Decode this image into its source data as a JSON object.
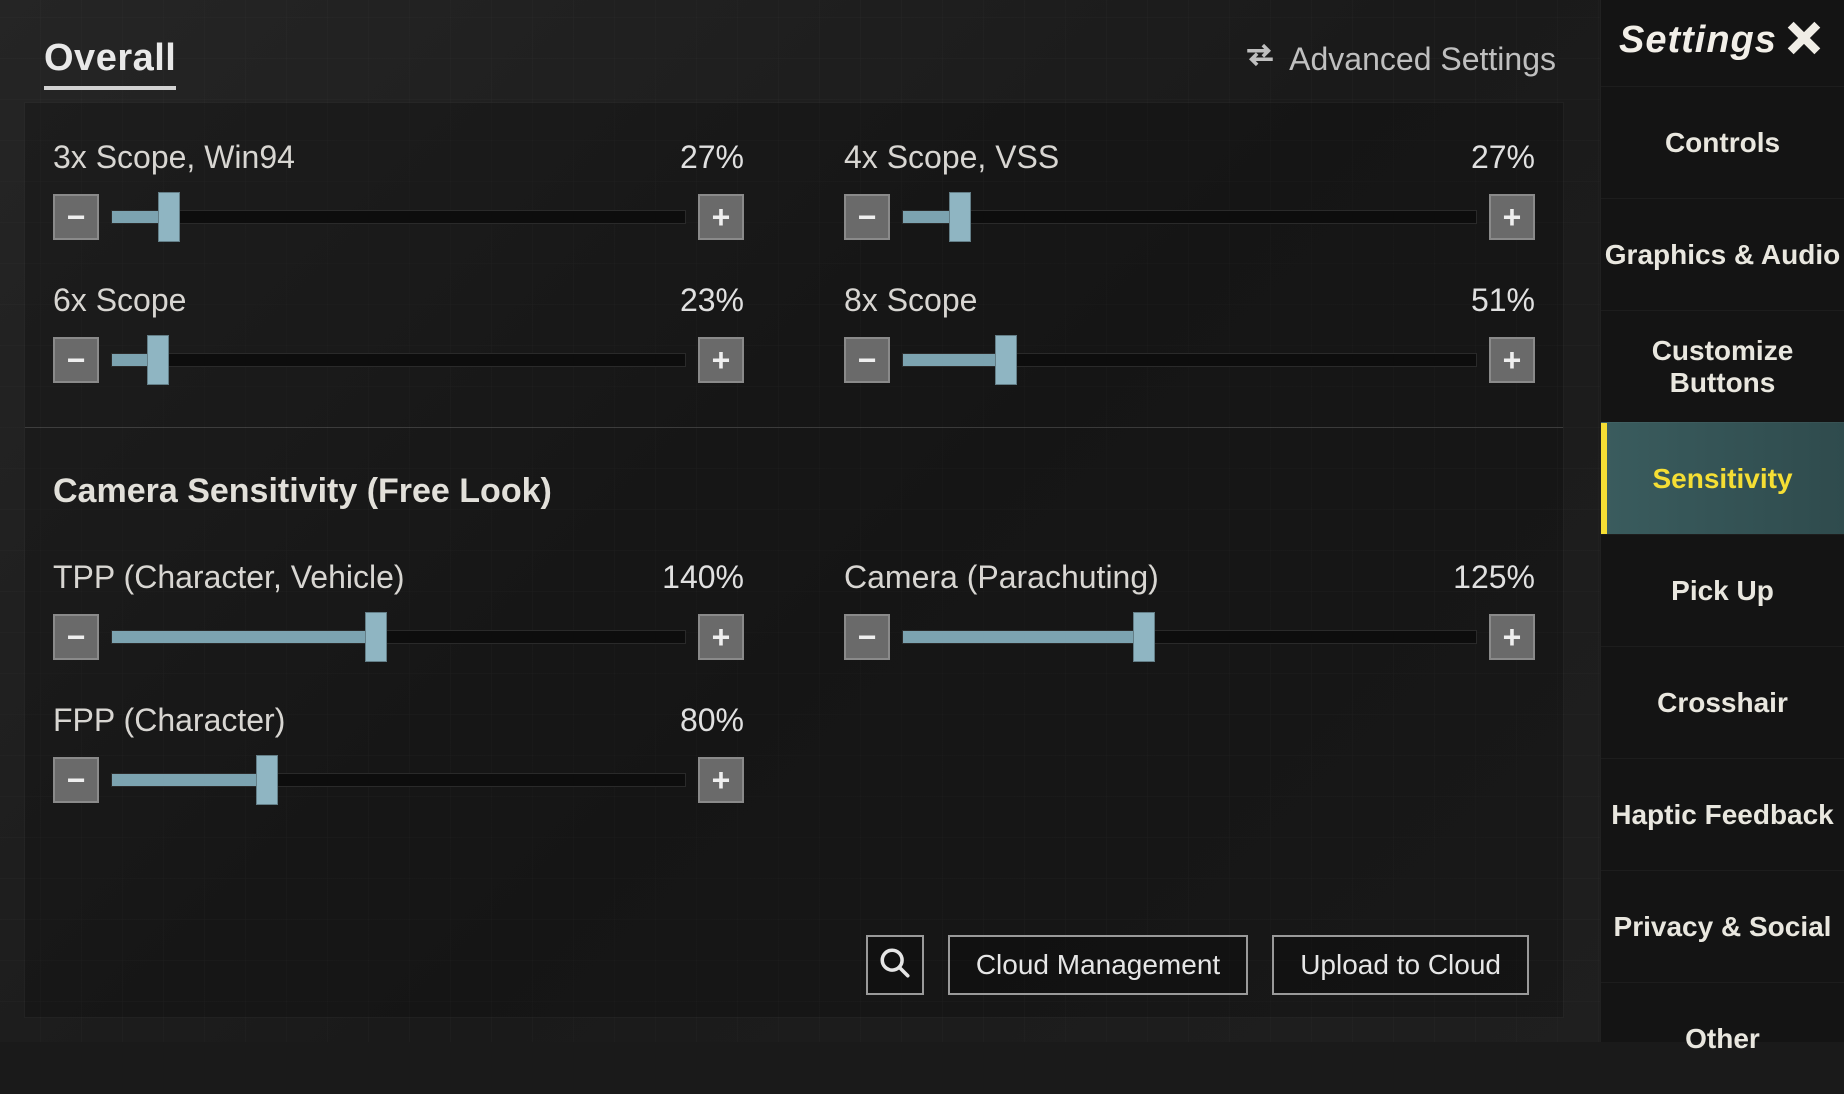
{
  "header": {
    "tab": "Overall",
    "advanced_label": "Advanced Settings",
    "settings_title": "Settings"
  },
  "sliders_top": [
    {
      "label": "3x Scope, Win94",
      "value": "27%",
      "fill": 10
    },
    {
      "label": "4x Scope, VSS",
      "value": "27%",
      "fill": 10
    },
    {
      "label": "6x Scope",
      "value": "23%",
      "fill": 8
    },
    {
      "label": "8x Scope",
      "value": "51%",
      "fill": 18
    }
  ],
  "section_freelook_title": "Camera Sensitivity (Free Look)",
  "sliders_freelook": [
    {
      "label": "TPP (Character, Vehicle)",
      "value": "140%",
      "fill": 46
    },
    {
      "label": "Camera (Parachuting)",
      "value": "125%",
      "fill": 42
    },
    {
      "label": "FPP (Character)",
      "value": "80%",
      "fill": 27
    }
  ],
  "footer": {
    "cloud_mgmt": "Cloud Management",
    "upload": "Upload to Cloud"
  },
  "nav": {
    "items": [
      {
        "label": "Controls"
      },
      {
        "label": "Graphics & Audio"
      },
      {
        "label": "Customize Buttons"
      },
      {
        "label": "Sensitivity",
        "active": true
      },
      {
        "label": "Pick Up"
      },
      {
        "label": "Crosshair"
      },
      {
        "label": "Haptic Feedback"
      },
      {
        "label": "Privacy & Social"
      },
      {
        "label": "Other"
      }
    ]
  }
}
